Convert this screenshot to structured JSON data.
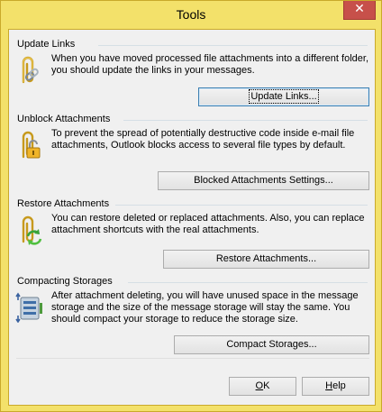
{
  "window": {
    "title": "Tools",
    "close_glyph": "✕",
    "accent_color": "#f3e16a"
  },
  "sections": [
    {
      "heading": "Update Links",
      "icon": "paperclip-chain-link-icon",
      "text": "When you have moved processed file attachments into a different folder, you should update the links in your messages.",
      "button": "Update Links..."
    },
    {
      "heading": "Unblock Attachments",
      "icon": "paperclip-padlock-icon",
      "text": "To prevent the spread of potentially destructive code inside e-mail file attachments, Outlook blocks access to several file types by default.",
      "button": "Blocked Attachments Settings..."
    },
    {
      "heading": "Restore Attachments",
      "icon": "paperclip-restore-arrows-icon",
      "text": "You can restore deleted or replaced attachments. Also, you can replace attachment shortcuts with the real attachments.",
      "button": "Restore Attachments..."
    },
    {
      "heading": "Compacting Storages",
      "icon": "storage-compress-icon",
      "text": "After attachment deleting, you will have unused space in the message storage and the size of the message storage will stay the same. You should compact your storage to reduce the storage size.",
      "button": "Compact Storages..."
    }
  ],
  "footer": {
    "ok_underlined": "O",
    "ok_rest": "K",
    "help_underlined": "H",
    "help_rest": "elp"
  }
}
